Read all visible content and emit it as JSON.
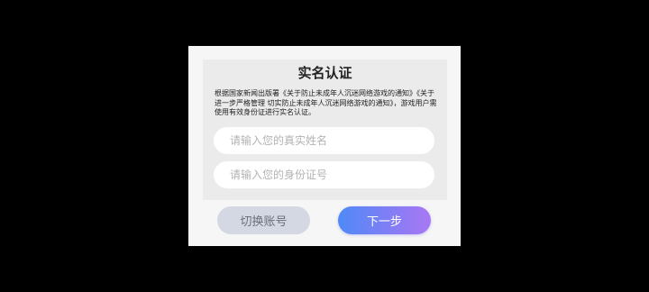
{
  "dialog": {
    "title": "实名认证",
    "notice": "根据国家新闻出版署《关于防止未成年人沉迷网络游戏的通知》《关于进一步严格管理 切实防止未成年人沉迷网络游戏的通知》，游戏用户需使用有效身份证进行实名认证。",
    "name_field": {
      "placeholder": "请输入您的真实姓名",
      "value": ""
    },
    "id_field": {
      "placeholder": "请输入您的身份证号",
      "value": ""
    },
    "switch_account_label": "切换账号",
    "next_label": "下一步"
  },
  "colors": {
    "page_background": "#000000",
    "dialog_background": "#f6f6f6",
    "panel_background": "#ebebeb",
    "secondary_button": "#d4d8e3",
    "primary_gradient_start": "#4f8af6",
    "primary_gradient_end": "#a978f3"
  }
}
